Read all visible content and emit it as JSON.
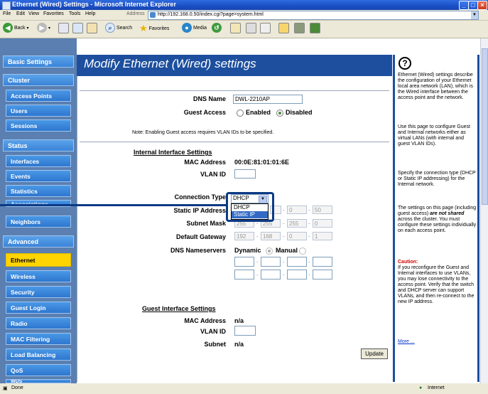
{
  "window": {
    "title": "Ethernet (Wired) Settings - Microsoft Internet Explorer",
    "min": "_",
    "max": "□",
    "close": "×"
  },
  "menu": {
    "items": [
      "File",
      "Edit",
      "View",
      "Favorites",
      "Tools",
      "Help"
    ],
    "address_label": "Address",
    "url": "http://192.168.0.50/index.cgi?page=system.html"
  },
  "toolbar": {
    "back": "Back",
    "search": "Search",
    "favorites": "Favorites",
    "media": "Media"
  },
  "nav": {
    "basic_settings": "Basic Settings",
    "cluster": "Cluster",
    "access_points": "Access Points",
    "users": "Users",
    "sessions": "Sessions",
    "status": "Status",
    "interfaces": "Interfaces",
    "events": "Events",
    "statistics": "Statistics",
    "associations": "Associations",
    "neighbors": "Neighbors",
    "advanced": "Advanced",
    "ethernet": "Ethernet",
    "wireless": "Wireless",
    "security": "Security",
    "guest_login": "Guest Login",
    "radio": "Radio",
    "mac_filtering": "MAC Filtering",
    "load_balancing": "Load Balancing",
    "qos": "QoS",
    "wds": "WDS"
  },
  "main": {
    "title": "Modify Ethernet (Wired) settings",
    "dns_name_label": "DNS Name",
    "dns_name_value": "DWL-2210AP",
    "guest_access_label": "Guest Access",
    "enabled": "Enabled",
    "disabled": "Disabled",
    "note": "Note: Enabling Guest access requires VLAN IDs to be specified.",
    "internal_title": "Internal Interface Settings",
    "mac_label": "MAC Address",
    "mac_value": "00:0E:81:01:01:6E",
    "vlan_label": "VLAN ID",
    "conn_type_label": "Connection Type",
    "conn_type_value": "DHCP",
    "conn_options": [
      "DHCP",
      "Static IP"
    ],
    "static_ip_label": "Static IP Address",
    "static_ip": [
      "",
      "",
      "0",
      "50"
    ],
    "subnet_label": "Subnet Mask",
    "subnet": [
      "255",
      "255",
      "255",
      "0"
    ],
    "gateway_label": "Default Gateway",
    "gateway": [
      "192",
      "168",
      "0",
      "1"
    ],
    "dns_servers_label": "DNS Nameservers",
    "dynamic": "Dynamic",
    "manual": "Manual",
    "guest_title": "Guest Interface Settings",
    "guest_mac_value": "n/a",
    "subnet_short_label": "Subnet",
    "guest_subnet_value": "n/a",
    "update": "Update"
  },
  "help": {
    "icon": "?",
    "p1": "Ethernet (Wired) settings describe the configuration of your Ethernet local area network (LAN), which is the Wired interface between the access point and the network.",
    "p2": "Use this page to configure Guest and Internal networks either as virtual LANs (with internal and guest VLAN IDs).",
    "p3": "Specify the connection type (DHCP or Static IP addressing) for the Internal network.",
    "p4a": "The settings on this page (including guest access)",
    "p4b": "are not shared",
    "p4c": "across the cluster. You must configure these settings individually on each access point.",
    "caution_title": "Caution:",
    "caution": "If you reconfigure the Guest and Internal interfaces to use VLANs, you may lose connectivity to the access point. Verify that the switch and DHCP server can support VLANs, and then re-connect to the new IP address.",
    "more": "More ..."
  },
  "statusbar": {
    "left": "Done",
    "right": "Internet"
  },
  "colors": {
    "nav_blue": "#2d76cf",
    "active_yellow": "#ffd400",
    "header_blue": "#1d4f9e",
    "callout": "#0d3a86"
  }
}
